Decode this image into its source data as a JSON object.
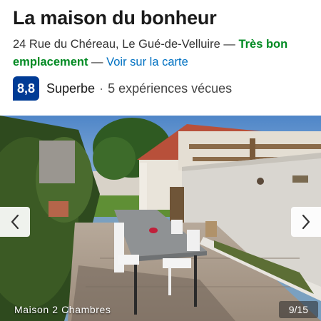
{
  "property": {
    "name": "La maison du bonheur",
    "address": "24 Rue du Chéreau, Le Gué-de-Velluire",
    "separator": " — ",
    "location_badge": "Très bon emplacement",
    "map_link": "Voir sur la carte"
  },
  "rating": {
    "score": "8,8",
    "label": "Superbe",
    "dot": "·",
    "reviews": "5 expériences vécues",
    "score_color": "#003b95"
  },
  "gallery": {
    "caption": "Maison 2 Chambres",
    "counter": "9/15",
    "prev_icon": "chevron-left-icon",
    "next_icon": "chevron-right-icon"
  },
  "colors": {
    "accent_green": "#008a22",
    "link_blue": "#0071c2"
  }
}
